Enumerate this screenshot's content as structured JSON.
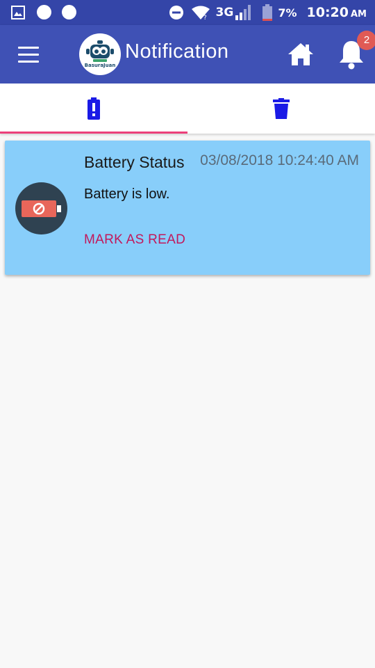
{
  "status_bar": {
    "network": "3G",
    "battery_percent": "7%",
    "time": "10:20",
    "ampm": "AM",
    "icons": [
      "image-icon",
      "circle-icon",
      "circle-icon",
      "do-not-disturb-icon",
      "wifi-icon",
      "signal-icon",
      "battery-icon"
    ]
  },
  "app_bar": {
    "title": "Notification",
    "logo_text": "BasuraJuan",
    "notification_count": "2",
    "color": "#3f51b5"
  },
  "tabs": [
    {
      "icon": "battery-alert-icon",
      "active": true
    },
    {
      "icon": "trash-icon",
      "active": false
    }
  ],
  "notifications": [
    {
      "title": "Battery Status",
      "date": "03/08/2018 10:24:40 AM",
      "message": "Battery is low.",
      "action_label": "MARK AS READ",
      "icon": "battery-empty-icon"
    }
  ],
  "colors": {
    "status_bar": "#3445a8",
    "accent": "#ec407a",
    "card": "#88cefa",
    "action": "#c2185b",
    "tab_icon": "#1a1ae6"
  }
}
